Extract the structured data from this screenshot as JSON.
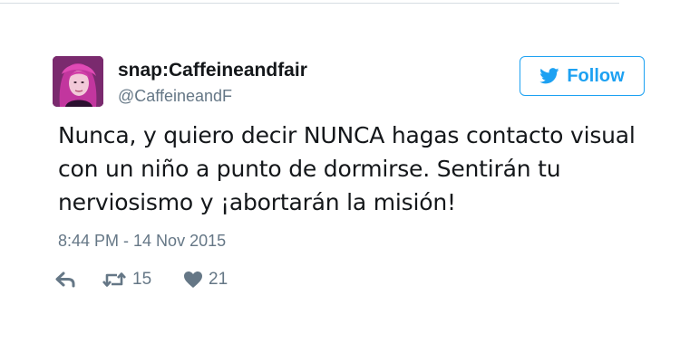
{
  "tweet": {
    "display_name": "snap:Caffeineandfair",
    "username": "@CaffeineandF",
    "follow_label": "Follow",
    "text_lines": [
      "Nunca, y quiero decir NUNCA hagas contacto visual",
      "con un niño a punto de dormirse. Sentirán tu",
      "nerviosismo y ¡abortarán la misión!"
    ],
    "timestamp": "8:44 PM - 14 Nov 2015",
    "retweet_count": "15",
    "like_count": "21"
  },
  "icons": {
    "avatar": "avatar-photo",
    "follow": "twitter-bird-icon",
    "reply": "reply-arrow-icon",
    "retweet": "retweet-icon",
    "like": "heart-icon"
  },
  "colors": {
    "accent": "#1da1f2",
    "text": "#14171a",
    "muted": "#657786"
  }
}
